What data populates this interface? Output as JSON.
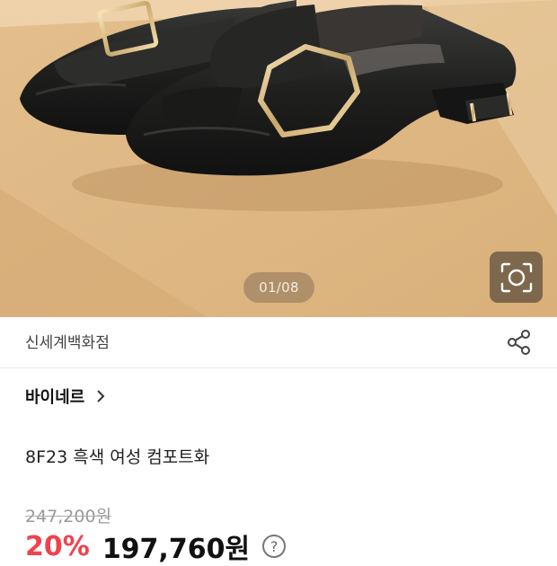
{
  "product_image": {
    "page_indicator": "01/08",
    "image_search_icon": "camera-search-icon"
  },
  "store": {
    "name": "신세계백화점",
    "share_icon": "share-icon"
  },
  "brand": {
    "name": "바이네르",
    "chevron_icon": "chevron-right-icon"
  },
  "product": {
    "title": "8F23 흑색 여성 컴포트화"
  },
  "price": {
    "original": "247,200원",
    "discount_rate": "20%",
    "sale": "197,760원",
    "help_icon_glyph": "?"
  },
  "colors": {
    "discount": "#f0424d",
    "text_primary": "#111111",
    "text_muted": "#999999"
  }
}
